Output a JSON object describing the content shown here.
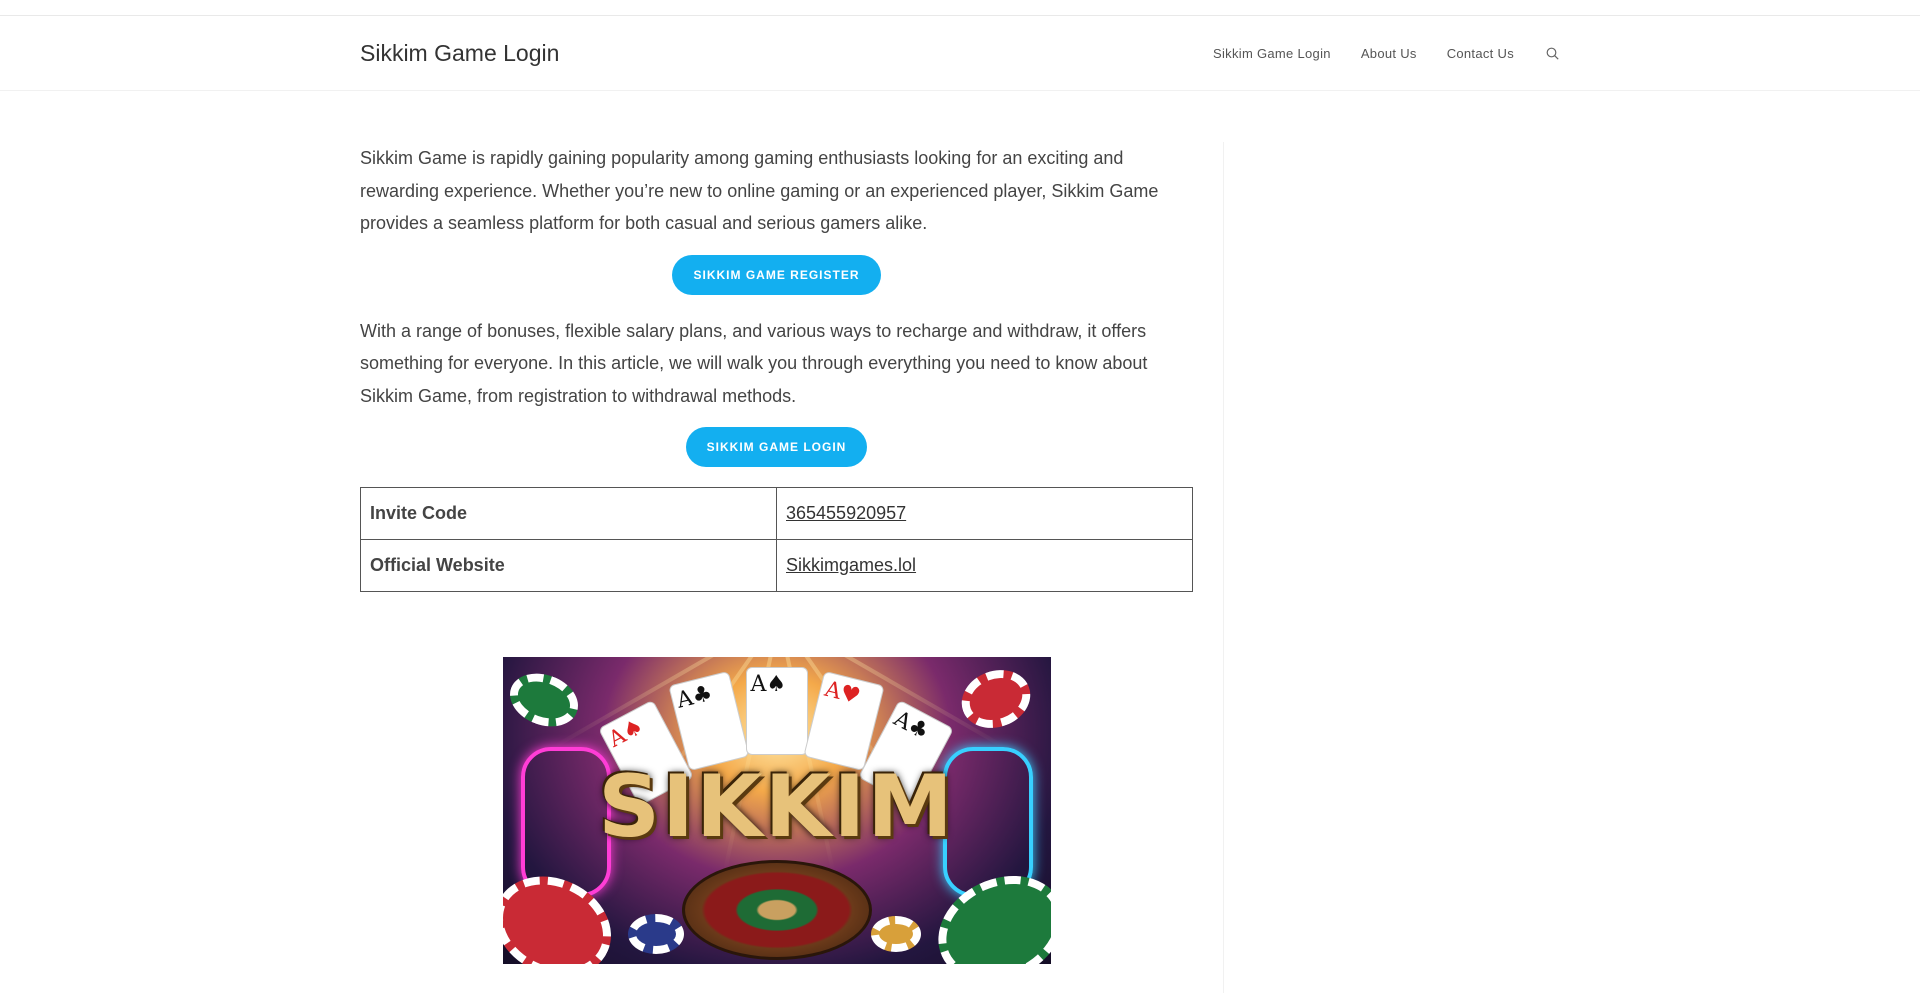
{
  "header": {
    "site_title": "Sikkim Game Login",
    "nav": [
      {
        "label": "Sikkim Game Login"
      },
      {
        "label": "About Us"
      },
      {
        "label": "Contact Us"
      }
    ],
    "search_icon": "search-icon"
  },
  "content": {
    "para1": "Sikkim Game is rapidly gaining popularity among gaming enthusiasts looking for an exciting and rewarding experience. Whether you’re new to online gaming or an experienced player, Sikkim Game provides a seamless platform for both casual and serious gamers alike.",
    "register_button": "SIKKIM GAME REGISTER",
    "para2": "With a range of bonuses, flexible salary plans, and various ways to recharge and withdraw, it offers something for everyone. In this article, we will walk you through everything you need to know about Sikkim Game, from registration to withdrawal methods.",
    "login_button": "SIKKIM GAME LOGIN",
    "table": [
      {
        "key": "Invite Code",
        "value": "365455920957"
      },
      {
        "key": "Official Website",
        "value": "Sikkimgames.lol"
      }
    ],
    "banner": {
      "logo_text": "SIKKIM",
      "cards": [
        "A♠",
        "A♣",
        "A♠",
        "A♥",
        "A♣"
      ]
    }
  },
  "colors": {
    "accent": "#13aff0",
    "text": "#444444",
    "border": "#555555"
  }
}
